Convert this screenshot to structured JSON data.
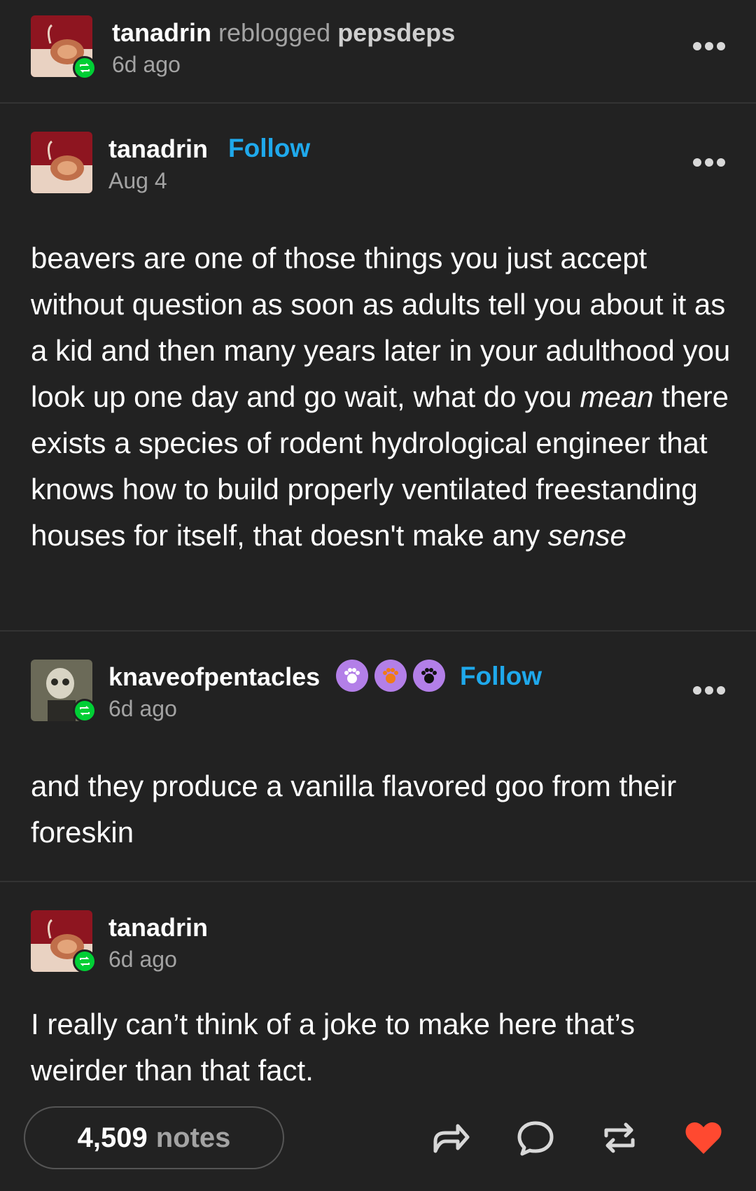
{
  "reblog_header": {
    "user": "tanadrin",
    "action": "reblogged",
    "source": "pepsdeps",
    "time": "6d ago"
  },
  "posts": [
    {
      "user": "tanadrin",
      "follow_label": "Follow",
      "time": "Aug 4",
      "text_parts": [
        "beavers are one of those things you just accept without question as soon as adults tell you about it as a kid and then many years later in your adulthood you look up one day and go wait, what do you ",
        "mean",
        " there exists a species of rodent hydrological engineer that knows how to build properly ventilated freestanding houses for itself, that doesn't make any ",
        "sense"
      ]
    },
    {
      "user": "knaveofpentacles",
      "follow_label": "Follow",
      "time": "6d ago",
      "badges": [
        "paw-badge-white",
        "paw-badge-orange",
        "paw-badge-black"
      ],
      "text": "and they produce a vanilla flavored goo from their foreskin"
    },
    {
      "user": "tanadrin",
      "time": "6d ago",
      "text": "I really can’t think of a joke to make here that’s weirder than that fact."
    }
  ],
  "footer": {
    "notes_count": "4,509",
    "notes_label": "notes",
    "actions": [
      "share-icon",
      "reply-icon",
      "reblog-icon",
      "like-icon"
    ]
  },
  "colors": {
    "background": "#222222",
    "follow": "#1fa9ec",
    "reblog_green": "#00cf35",
    "like_red": "#ff4930"
  }
}
